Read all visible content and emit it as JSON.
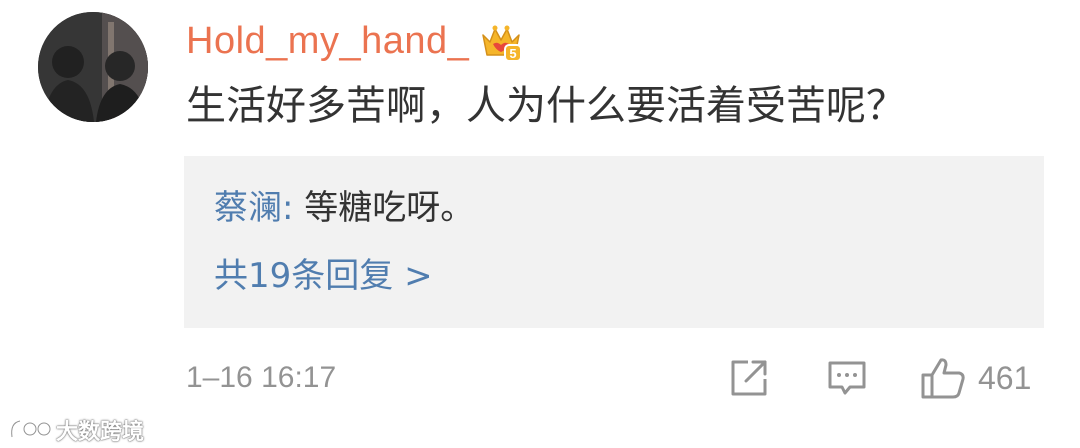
{
  "comment": {
    "username": "Hold_my_hand_",
    "badge_icon": "vip-crown-icon",
    "badge_level": "5",
    "text": "生活好多苦啊，人为什么要活着受苦呢？",
    "timestamp": "1–16 16:17",
    "like_count": "461"
  },
  "reply_preview": {
    "author": "蔡澜",
    "separator": ": ",
    "text": "等糖吃呀。",
    "more_replies_label": "共19条回复 >"
  },
  "actions": [
    {
      "name": "share",
      "icon": "share-icon"
    },
    {
      "name": "comment",
      "icon": "comment-icon"
    },
    {
      "name": "like",
      "icon": "thumbs-up-icon"
    }
  ],
  "watermark": {
    "text": "大数跨境"
  },
  "colors": {
    "username": "#eb7350",
    "reply_link": "#507daf",
    "muted": "#939393",
    "reply_bg": "#f2f2f2",
    "badge_gold": "#f5b52a",
    "badge_red": "#e8483b"
  }
}
